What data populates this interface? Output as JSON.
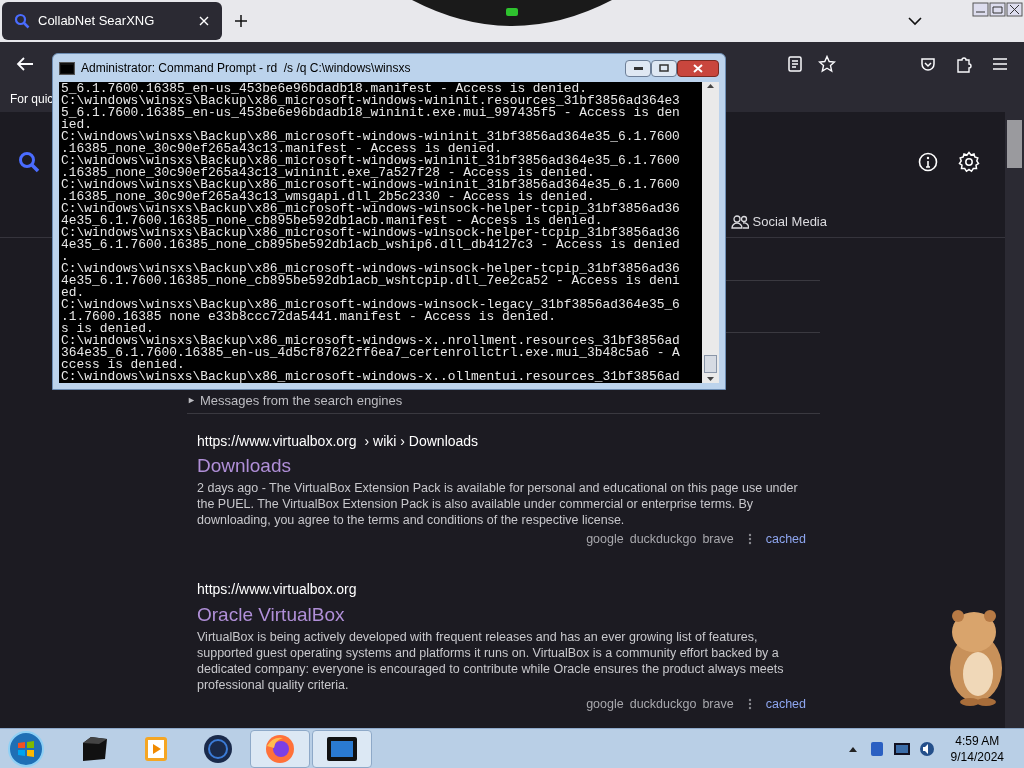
{
  "browser": {
    "tab": {
      "title": "CollabNet SearXNG",
      "selected": true
    },
    "bookmarks_text": "For quic",
    "categories": [
      {
        "label": "Social Media",
        "selected": false
      }
    ],
    "messages": {
      "toggle": "►",
      "label": "Messages from the search engines"
    },
    "results": [
      {
        "url": "https://www.virtualbox.org",
        "breadcrumb": "› wiki › Downloads",
        "title": "Downloads",
        "snippet": "2 days ago - The VirtualBox Extension Pack is available for personal and educational on this page use under the PUEL. The VirtualBox Extension Pack is also available under commercial or enterprise terms. By downloading, you agree to the terms and conditions of the respective license.",
        "engines": [
          "google",
          "duckduckgo",
          "brave"
        ],
        "cached": "cached"
      },
      {
        "url": "https://www.virtualbox.org",
        "title": "Oracle VirtualBox",
        "snippet": "VirtualBox is being actively developed with frequent releases and has an ever growing list of features, supported guest operating systems and platforms it runs on. VirtualBox is a community effort backed by a dedicated company: everyone is encouraged to contribute while Oracle ensures the product always meets professional quality criteria.",
        "engines": [
          "google",
          "duckduckgo",
          "brave"
        ],
        "cached": "cached"
      }
    ]
  },
  "cmd": {
    "title": "Administrator: Command Prompt - rd  /s /q C:\\windows\\winsxs",
    "lines": [
      "5_6.1.7600.16385_en-us_453be6e96bdadb18.manifest - Access is denied.",
      "C:\\windows\\winsxs\\Backup\\x86_microsoft-windows-wininit.resources_31bf3856ad364e3",
      "5_6.1.7600.16385_en-us_453be6e96bdadb18_wininit.exe.mui_997435f5 - Access is den",
      "ied.",
      "C:\\windows\\winsxs\\Backup\\x86_microsoft-windows-wininit_31bf3856ad364e35_6.1.7600",
      ".16385_none_30c90ef265a43c13.manifest - Access is denied.",
      "C:\\windows\\winsxs\\Backup\\x86_microsoft-windows-wininit_31bf3856ad364e35_6.1.7600",
      ".16385_none_30c90ef265a43c13_wininit.exe_7a527f28 - Access is denied.",
      "C:\\windows\\winsxs\\Backup\\x86_microsoft-windows-wininit_31bf3856ad364e35_6.1.7600",
      ".16385_none_30c90ef265a43c13_wmsgapi.dll_2b5c2330 - Access is denied.",
      "C:\\windows\\winsxs\\Backup\\x86_microsoft-windows-winsock-helper-tcpip_31bf3856ad36",
      "4e35_6.1.7600.16385_none_cb895be592db1acb.manifest - Access is denied.",
      "C:\\windows\\winsxs\\Backup\\x86_microsoft-windows-winsock-helper-tcpip_31bf3856ad36",
      "4e35_6.1.7600.16385_none_cb895be592db1acb_wship6.dll_db4127c3 - Access is denied",
      ".",
      "C:\\windows\\winsxs\\Backup\\x86_microsoft-windows-winsock-helper-tcpip_31bf3856ad36",
      "4e35_6.1.7600.16385_none_cb895be592db1acb_wshtcpip.dll_7ee2ca52 - Access is deni",
      "ed.",
      "C:\\windows\\winsxs\\Backup\\x86_microsoft-windows-winsock-legacy_31bf3856ad364e35_6",
      ".1.7600.16385 none e33b8ccc72da5441.manifest - Access is denied.",
      "s is denied.",
      "C:\\windows\\winsxs\\Backup\\x86_microsoft-windows-x..nrollment.resources_31bf3856ad",
      "364e35_6.1.7600.16385_en-us_4d5cf87622ff6ea7_certenrollctrl.exe.mui_3b48c5a6 - A",
      "ccess is denied.",
      "C:\\windows\\winsxs\\Backup\\x86_microsoft-windows-x..ollmentui.resources_31bf3856ad"
    ]
  },
  "taskbar": {
    "apps": [
      {
        "kind": "terminal-box",
        "active": false
      },
      {
        "kind": "media",
        "active": false
      },
      {
        "kind": "globe",
        "active": false
      },
      {
        "kind": "firefox",
        "active": true
      },
      {
        "kind": "monitor",
        "active": true
      }
    ],
    "clock": {
      "time": "4:59 AM",
      "date": "9/14/2024"
    }
  }
}
